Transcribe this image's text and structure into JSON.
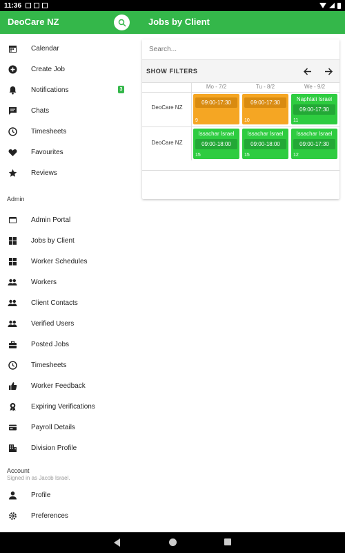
{
  "status_bar": {
    "time": "11:36"
  },
  "app_bar": {
    "app_title": "DeoCare NZ",
    "page_title": "Jobs by Client"
  },
  "drawer": {
    "items": [
      {
        "label": "Calendar",
        "icon": "calendar-icon"
      },
      {
        "label": "Create Job",
        "icon": "add-circle-icon"
      },
      {
        "label": "Notifications",
        "icon": "bell-icon",
        "badge": "3"
      },
      {
        "label": "Chats",
        "icon": "chat-icon"
      },
      {
        "label": "Timesheets",
        "icon": "clock-icon"
      },
      {
        "label": "Favourites",
        "icon": "heart-icon"
      },
      {
        "label": "Reviews",
        "icon": "star-icon"
      }
    ],
    "admin_label": "Admin",
    "admin_items": [
      {
        "label": "Admin Portal",
        "icon": "portal-icon"
      },
      {
        "label": "Jobs by Client",
        "icon": "grid-icon"
      },
      {
        "label": "Worker Schedules",
        "icon": "grid-icon"
      },
      {
        "label": "Workers",
        "icon": "people-icon"
      },
      {
        "label": "Client Contacts",
        "icon": "people-icon"
      },
      {
        "label": "Verified Users",
        "icon": "people-icon"
      },
      {
        "label": "Posted Jobs",
        "icon": "briefcase-icon"
      },
      {
        "label": "Timesheets",
        "icon": "clock-icon"
      },
      {
        "label": "Worker Feedback",
        "icon": "thumbs-up-icon"
      },
      {
        "label": "Expiring Verifications",
        "icon": "award-icon"
      },
      {
        "label": "Payroll Details",
        "icon": "card-icon"
      },
      {
        "label": "Division Profile",
        "icon": "building-icon"
      }
    ],
    "account_label": "Account",
    "signed_in_text": "Signed in as Jacob Israel.",
    "account_items": [
      {
        "label": "Profile",
        "icon": "person-icon"
      },
      {
        "label": "Preferences",
        "icon": "settings-icon"
      }
    ]
  },
  "main": {
    "search_placeholder": "Search...",
    "show_filters": "SHOW FILTERS",
    "days": [
      "Mo - 7/2",
      "Tu - 8/2",
      "We - 9/2"
    ],
    "rows": [
      {
        "client": "DeoCare NZ",
        "jobs": [
          {
            "worker": "",
            "time": "09:00-17:30",
            "num": "9",
            "color": "#f5a623"
          },
          {
            "worker": "",
            "time": "09:00-17:30",
            "num": "10",
            "color": "#f5a623"
          },
          {
            "worker": "Naphtali Israel",
            "time": "09:00-17:30",
            "num": "11",
            "color": "#2ecc40"
          }
        ]
      },
      {
        "client": "DeoCare NZ",
        "jobs": [
          {
            "worker": "Issachar Israel",
            "time": "09:00-18:00",
            "num": "15",
            "color": "#2ecc40"
          },
          {
            "worker": "Issachar Israel",
            "time": "09:00-18:00",
            "num": "15",
            "color": "#2ecc40"
          },
          {
            "worker": "Issachar Israel",
            "time": "09:00-17:30",
            "num": "12",
            "color": "#2ecc40"
          }
        ]
      }
    ]
  },
  "colors": {
    "primary": "#34b74a",
    "pending": "#f5a623",
    "confirmed": "#2ecc40"
  }
}
